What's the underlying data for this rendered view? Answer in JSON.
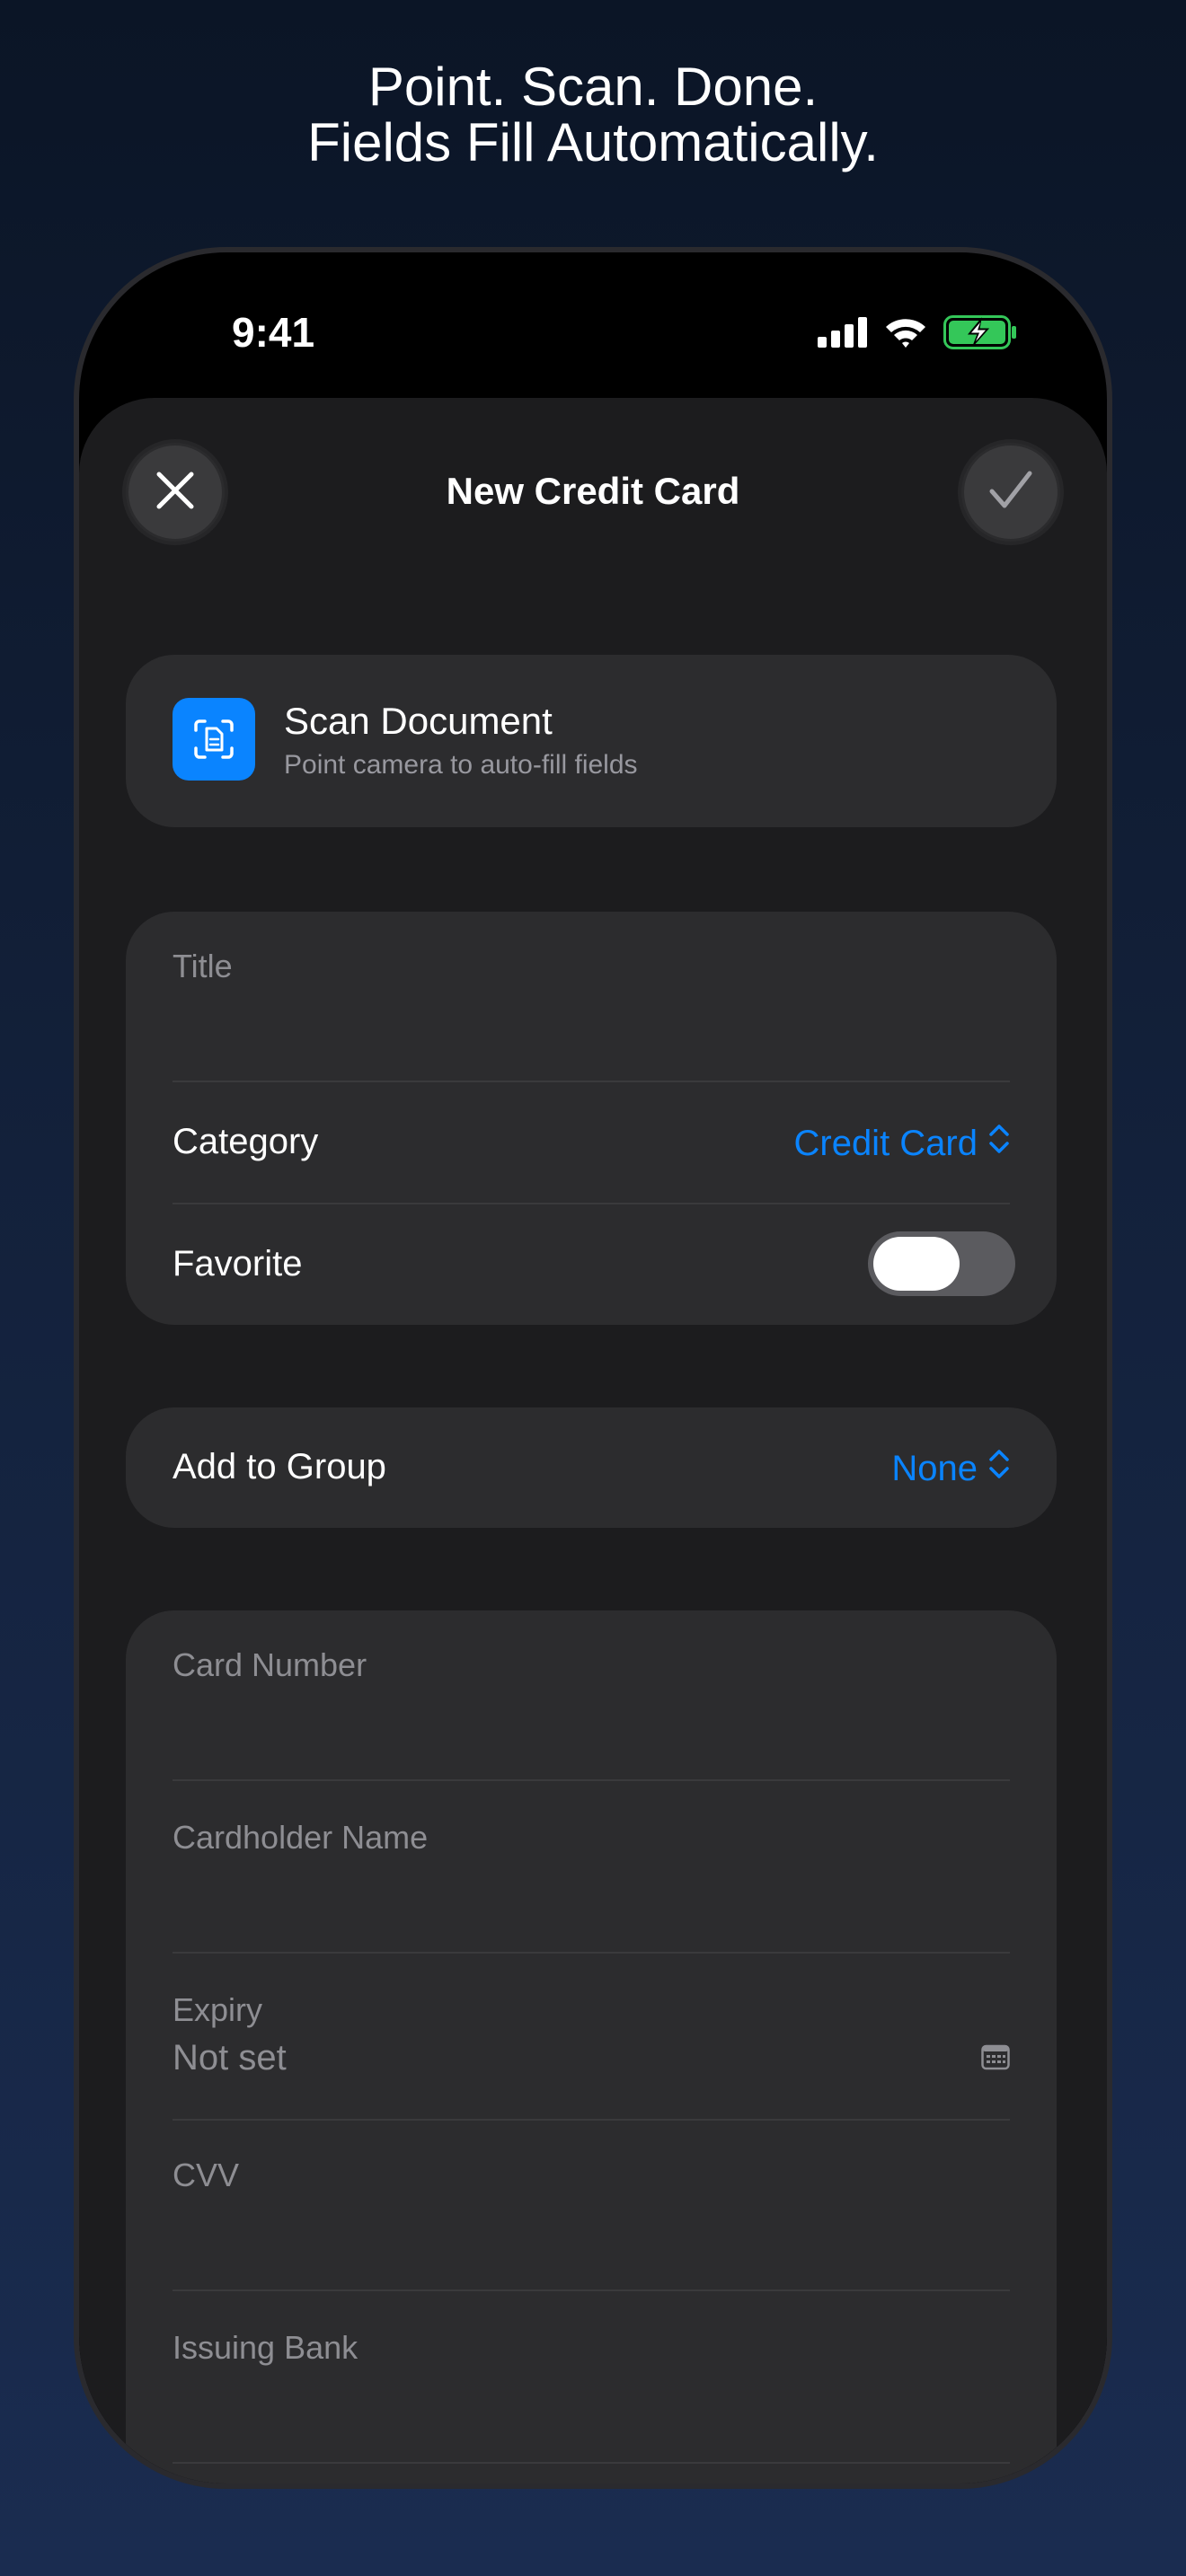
{
  "headline": {
    "line1": "Point. Scan. Done.",
    "line2": "Fields Fill Automatically."
  },
  "status_bar": {
    "time": "9:41",
    "icons": [
      "cellular-signal-icon",
      "wifi-icon",
      "battery-charging-icon"
    ],
    "battery_color": "#34c759"
  },
  "nav": {
    "title": "New Credit Card",
    "close_icon": "close-icon",
    "confirm_icon": "checkmark-icon"
  },
  "scan": {
    "title": "Scan Document",
    "subtitle": "Point camera to auto-fill fields",
    "icon": "document-scan-icon",
    "icon_color": "#0a84ff"
  },
  "general": {
    "title_label": "Title",
    "title_value": "",
    "category_label": "Category",
    "category_value": "Credit Card",
    "favorite_label": "Favorite",
    "favorite_on": false
  },
  "group": {
    "label": "Add to Group",
    "value": "None"
  },
  "card_fields": {
    "card_number_label": "Card Number",
    "cardholder_label": "Cardholder Name",
    "expiry_label": "Expiry",
    "expiry_value": "Not set",
    "cvv_label": "CVV",
    "issuing_bank_label": "Issuing Bank"
  },
  "accent_color": "#0a84ff"
}
